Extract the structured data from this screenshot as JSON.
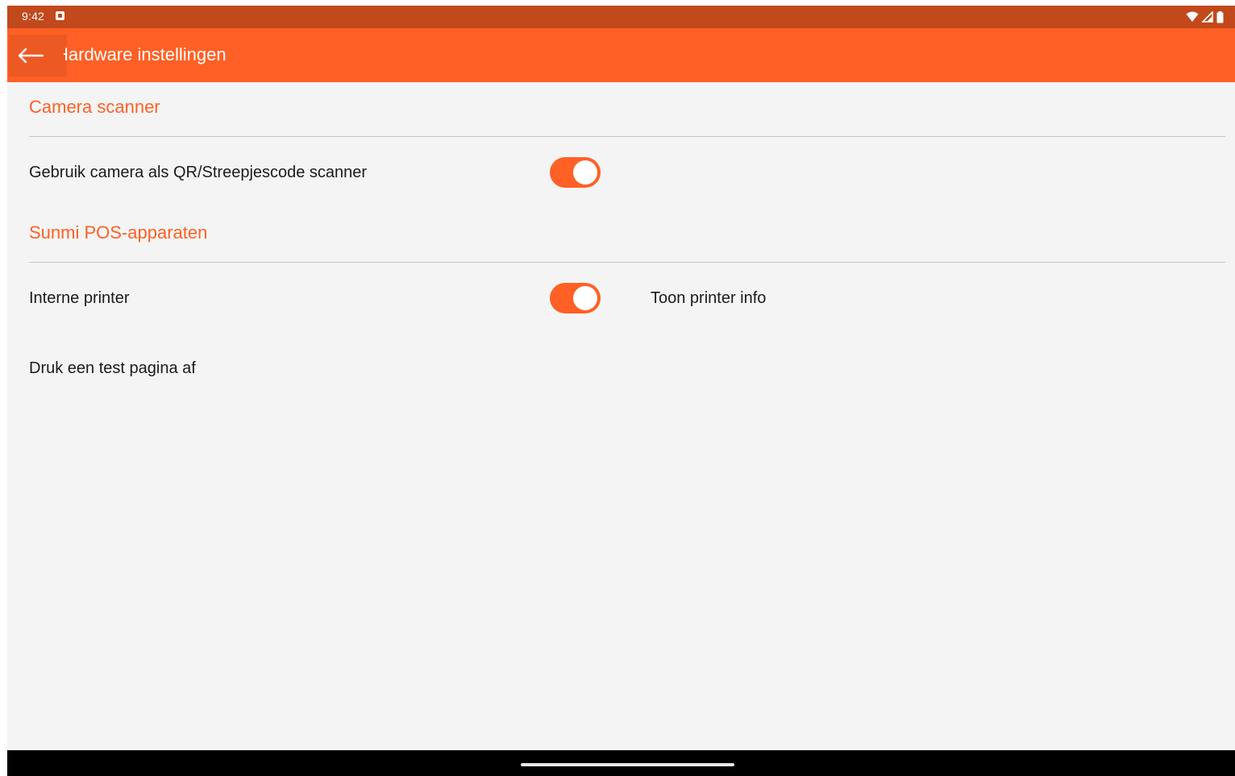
{
  "status_bar": {
    "time": "9:42",
    "icons": [
      "notification-icon",
      "wifi-icon",
      "signal-icon",
      "battery-icon"
    ]
  },
  "toolbar": {
    "title": "Hardware instellingen",
    "back_icon": "arrow-back-icon"
  },
  "sections": {
    "camera": {
      "header": "Camera scanner",
      "rows": [
        {
          "label": "Gebruik camera als QR/Streepjescode scanner",
          "toggle_on": true
        }
      ]
    },
    "sunmi": {
      "header": "Sunmi POS-apparaten",
      "rows": [
        {
          "label": "Interne printer",
          "toggle_on": true,
          "link_label": "Toon printer info"
        },
        {
          "label": "Druk een test pagina af"
        }
      ]
    }
  },
  "colors": {
    "accent": "#ff6025",
    "status_bar": "#c1491c",
    "background": "#f4f4f4",
    "text": "#1b1b1b",
    "divider": "#c4c4c4"
  }
}
